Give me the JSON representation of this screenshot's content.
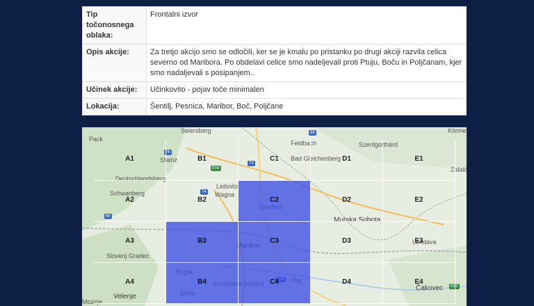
{
  "table": {
    "rows": [
      {
        "label": "Tip točonosnega oblaka:",
        "value": "Frontalni izvor"
      },
      {
        "label": "Opis akcije:",
        "value": "Za tretjo akcijo smo se odločili, ker se je kmalu po pristanku po drugi akciji razvila celica severno od Maribora. Po obdelavi celice smo nadeljevali proti Ptuju, Boču in Poljčanam, kjer smo nadaljevali s posipanjem.."
      },
      {
        "label": "Učinek akcije:",
        "value": "Učinkovito - pojav toče minimalen"
      },
      {
        "label": "Lokacija:",
        "value": "Šentilj, Pesnica, Maribor, Boč, Poljčane"
      }
    ]
  },
  "map": {
    "highlight_color": "#3c50e6",
    "cells": [
      {
        "label": "A1",
        "highlighted": false
      },
      {
        "label": "B1",
        "highlighted": false
      },
      {
        "label": "C1",
        "highlighted": false
      },
      {
        "label": "D1",
        "highlighted": false
      },
      {
        "label": "E1",
        "highlighted": false
      },
      {
        "label": "A2",
        "highlighted": false
      },
      {
        "label": "B2",
        "highlighted": false
      },
      {
        "label": "C2",
        "highlighted": true
      },
      {
        "label": "D2",
        "highlighted": false
      },
      {
        "label": "E2",
        "highlighted": false
      },
      {
        "label": "A3",
        "highlighted": false
      },
      {
        "label": "B3",
        "highlighted": true
      },
      {
        "label": "C3",
        "highlighted": true
      },
      {
        "label": "D3",
        "highlighted": false
      },
      {
        "label": "E3",
        "highlighted": false
      },
      {
        "label": "A4",
        "highlighted": false
      },
      {
        "label": "B4",
        "highlighted": true
      },
      {
        "label": "C4",
        "highlighted": true
      },
      {
        "label": "D4",
        "highlighted": false
      },
      {
        "label": "E4",
        "highlighted": false
      }
    ],
    "places": [
      "Seiersberg",
      "Pack",
      "Stainz",
      "Feldbach",
      "Szentgotthárd",
      "Körme",
      "Bad Gleichenberg",
      "Deutschlandsberg",
      "Schwanberg",
      "Leibnitz",
      "Wagna",
      "Spielfeld",
      "Zalalö",
      "Murska Sobota",
      "Maribor",
      "Slovenj Gradec",
      "Lendava",
      "Rogla",
      "Slovenska Bistrica",
      "Ptuj",
      "Zreče",
      "Velenje",
      "Čakovec",
      "Mozirje"
    ],
    "shields": [
      "76",
      "E59",
      "73",
      "66",
      "74",
      "69",
      "E65",
      "E59"
    ]
  }
}
